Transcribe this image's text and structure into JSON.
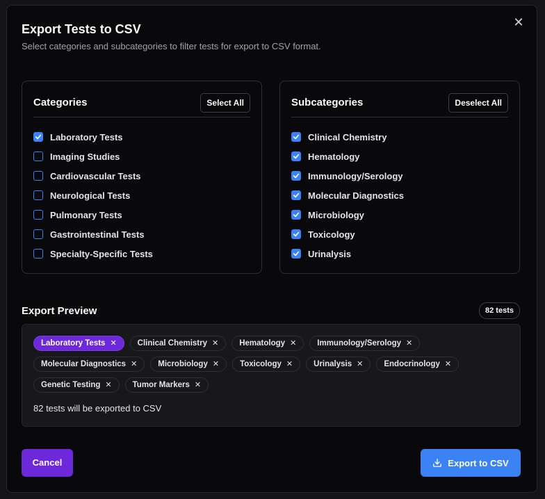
{
  "dialog": {
    "title": "Export Tests to CSV",
    "subtitle": "Select categories and subcategories to filter tests for export to CSV format.",
    "close_icon": "close-icon"
  },
  "categories": {
    "title": "Categories",
    "button_label": "Select All",
    "items": [
      {
        "label": "Laboratory Tests",
        "checked": true
      },
      {
        "label": "Imaging Studies",
        "checked": false
      },
      {
        "label": "Cardiovascular Tests",
        "checked": false
      },
      {
        "label": "Neurological Tests",
        "checked": false
      },
      {
        "label": "Pulmonary Tests",
        "checked": false
      },
      {
        "label": "Gastrointestinal Tests",
        "checked": false
      },
      {
        "label": "Specialty-Specific Tests",
        "checked": false
      }
    ]
  },
  "subcategories": {
    "title": "Subcategories",
    "button_label": "Deselect All",
    "items": [
      {
        "label": "Clinical Chemistry",
        "checked": true
      },
      {
        "label": "Hematology",
        "checked": true
      },
      {
        "label": "Immunology/Serology",
        "checked": true
      },
      {
        "label": "Molecular Diagnostics",
        "checked": true
      },
      {
        "label": "Microbiology",
        "checked": true
      },
      {
        "label": "Toxicology",
        "checked": true
      },
      {
        "label": "Urinalysis",
        "checked": true
      }
    ]
  },
  "preview": {
    "title": "Export Preview",
    "count_badge": "82 tests",
    "chips": [
      {
        "label": "Laboratory Tests",
        "active": true
      },
      {
        "label": "Clinical Chemistry",
        "active": false
      },
      {
        "label": "Hematology",
        "active": false
      },
      {
        "label": "Immunology/Serology",
        "active": false
      },
      {
        "label": "Molecular Diagnostics",
        "active": false
      },
      {
        "label": "Microbiology",
        "active": false
      },
      {
        "label": "Toxicology",
        "active": false
      },
      {
        "label": "Urinalysis",
        "active": false
      },
      {
        "label": "Endocrinology",
        "active": false
      },
      {
        "label": "Genetic Testing",
        "active": false
      },
      {
        "label": "Tumor Markers",
        "active": false
      }
    ],
    "chip_remove_glyph": "✕",
    "note": "82 tests will be exported to CSV"
  },
  "footer": {
    "cancel_label": "Cancel",
    "export_label": "Export to CSV",
    "export_icon": "download-icon"
  },
  "colors": {
    "accent_purple": "#6d28d9",
    "accent_blue": "#3b82f6",
    "background": "#09090b"
  }
}
